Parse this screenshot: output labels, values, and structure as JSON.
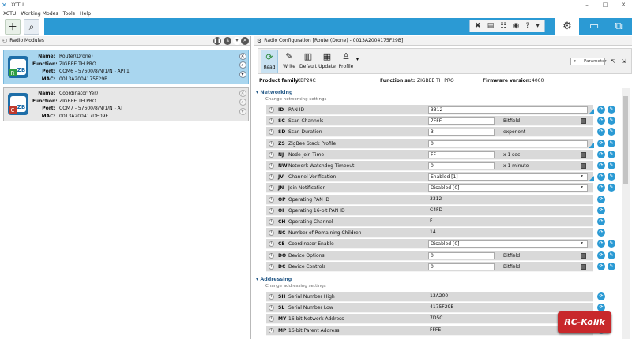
{
  "window": {
    "title": "XCTU",
    "controls": [
      "–",
      "□",
      "✕"
    ]
  },
  "menu": [
    "XCTU",
    "Working Modes",
    "Tools",
    "Help"
  ],
  "left_panel": {
    "title": "Radio Modules",
    "modules": [
      {
        "name_label": "Name:",
        "name": "Router(Drone)",
        "function_label": "Function:",
        "function": "ZIGBEE TH PRO",
        "port_label": "Port:",
        "port": "COM6 - 57600/8/N/1/N - API 1",
        "mac_label": "MAC:",
        "mac": "0013A2004175F29B",
        "icon_letters": [
          "R",
          "ZB"
        ]
      },
      {
        "name_label": "Name:",
        "name": "Coordinator(Yer)",
        "function_label": "Function:",
        "function": "ZIGBEE TH PRO",
        "port_label": "Port:",
        "port": "COM7 - 57600/8/N/1/N - AT",
        "mac_label": "MAC:",
        "mac": "0013A200417DE09E",
        "icon_letters": [
          "C",
          "ZB"
        ]
      }
    ]
  },
  "right_panel": {
    "title": "Radio Configuration [Router(Drone) - 0013A2004175F29B]",
    "actions": [
      "Read",
      "Write",
      "Default",
      "Update",
      "Profile"
    ],
    "search_placeholder": "Parameter",
    "info": {
      "family_label": "Product family:",
      "family": "XBP24C",
      "fset_label": "Function set:",
      "fset": "ZIGBEE TH PRO",
      "fw_label": "Firmware version:",
      "fw": "4060"
    },
    "sections": [
      {
        "title": "Networking",
        "subtitle": "Change networking settings"
      },
      {
        "title": "Addressing",
        "subtitle": "Change addressing settings"
      }
    ],
    "networking": [
      {
        "cmd": "ID",
        "name": "PAN ID",
        "value": "3312",
        "unit": ""
      },
      {
        "cmd": "SC",
        "name": "Scan Channels",
        "value": "7FFF",
        "unit": "Bitfield"
      },
      {
        "cmd": "SD",
        "name": "Scan Duration",
        "value": "3",
        "unit": "exponent"
      },
      {
        "cmd": "ZS",
        "name": "ZigBee Stack Profile",
        "value": "0",
        "unit": ""
      },
      {
        "cmd": "NJ",
        "name": "Node Join Time",
        "value": "FF",
        "unit": "x 1 sec"
      },
      {
        "cmd": "NW",
        "name": "Network Watchdog Timeout",
        "value": "0",
        "unit": "x 1 minute"
      },
      {
        "cmd": "JV",
        "name": "Channel Verification",
        "value": "Enabled [1]",
        "unit": ""
      },
      {
        "cmd": "JN",
        "name": "Join Notification",
        "value": "Disabled [0]",
        "unit": ""
      },
      {
        "cmd": "OP",
        "name": "Operating PAN ID",
        "value": "3312",
        "unit": ""
      },
      {
        "cmd": "OI",
        "name": "Operating 16-bit PAN ID",
        "value": "C4FD",
        "unit": ""
      },
      {
        "cmd": "CH",
        "name": "Operating Channel",
        "value": "F",
        "unit": ""
      },
      {
        "cmd": "NC",
        "name": "Number of Remaining Children",
        "value": "14",
        "unit": ""
      },
      {
        "cmd": "CE",
        "name": "Coordinator Enable",
        "value": "Disabled [0]",
        "unit": ""
      },
      {
        "cmd": "DO",
        "name": "Device Options",
        "value": "0",
        "unit": "Bitfield"
      },
      {
        "cmd": "DC",
        "name": "Device Controls",
        "value": "0",
        "unit": "Bitfield"
      }
    ],
    "addressing": [
      {
        "cmd": "SH",
        "name": "Serial Number High",
        "value": "13A200",
        "unit": ""
      },
      {
        "cmd": "SL",
        "name": "Serial Number Low",
        "value": "4175F29B",
        "unit": ""
      },
      {
        "cmd": "MY",
        "name": "16-bit Network Address",
        "value": "7D5C",
        "unit": ""
      },
      {
        "cmd": "MP",
        "name": "16-bit Parent Address",
        "value": "FFFE",
        "unit": ""
      }
    ]
  },
  "watermark": "RC-Kolik",
  "colors": {
    "accent": "#2b9ad4",
    "selected": "#a9d6ef",
    "row": "#d9d9d9",
    "watermark": "#c8282b"
  }
}
